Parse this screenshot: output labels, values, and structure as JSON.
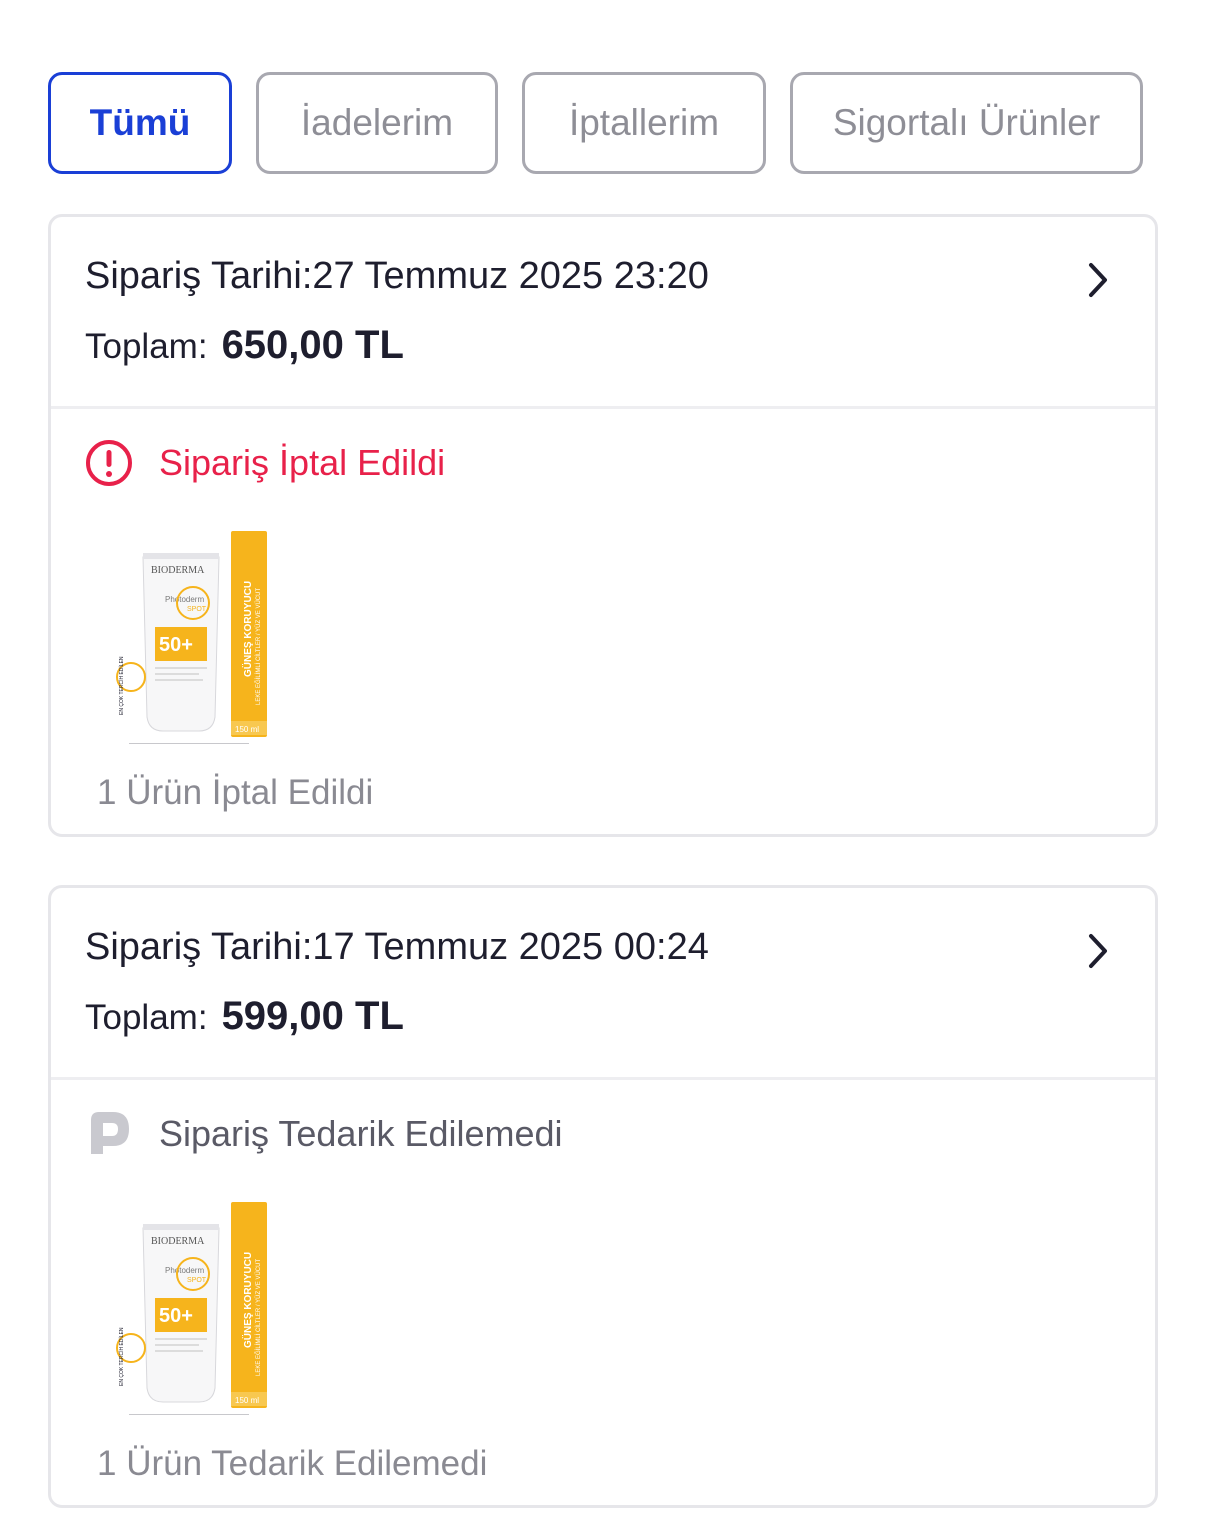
{
  "tabs": [
    {
      "label": "Tümü",
      "active": true
    },
    {
      "label": "İadelerim",
      "active": false
    },
    {
      "label": "İptallerim",
      "active": false
    },
    {
      "label": "Sigortalı Ürünler",
      "active": false
    }
  ],
  "orders": [
    {
      "date": "Sipariş Tarihi:27 Temmuz 2025 23:20",
      "total_label": "Toplam:",
      "total_value": "650,00 TL",
      "status": "Sipariş İptal Edildi",
      "status_icon": "alert-circle-icon",
      "status_color": "#e8214a",
      "summary": "1 Ürün İptal Edildi",
      "product": {
        "brand": "BIODERMA",
        "name": "Photoderm",
        "variant": "SPOT",
        "spf": "50+",
        "side_title": "GÜNEŞ KORUYUCU",
        "side_sub": "LEKE EĞİLİMLİ CİLTLER / YÜZ VE VÜCUT",
        "volume": "150 ml",
        "badge": "EN ÇOK TERCİH EDİLEN"
      }
    },
    {
      "date": "Sipariş Tarihi:17 Temmuz 2025 00:24",
      "total_label": "Toplam:",
      "total_value": "599,00 TL",
      "status": "Sipariş Tedarik Edilemedi",
      "status_icon": "p-logo-icon",
      "status_color": "#5a5a66",
      "summary": "1 Ürün Tedarik Edilemedi",
      "product": {
        "brand": "BIODERMA",
        "name": "Photoderm",
        "variant": "SPOT",
        "spf": "50+",
        "side_title": "GÜNEŞ KORUYUCU",
        "side_sub": "LEKE EĞİLİMLİ CİLTLER / YÜZ VE VÜCUT",
        "volume": "150 ml",
        "badge": "EN ÇOK TERCİH EDİLEN"
      }
    }
  ],
  "colors": {
    "accent": "#1a3fd6",
    "cancel_red": "#e8214a",
    "product_yellow": "#f6b41c"
  }
}
